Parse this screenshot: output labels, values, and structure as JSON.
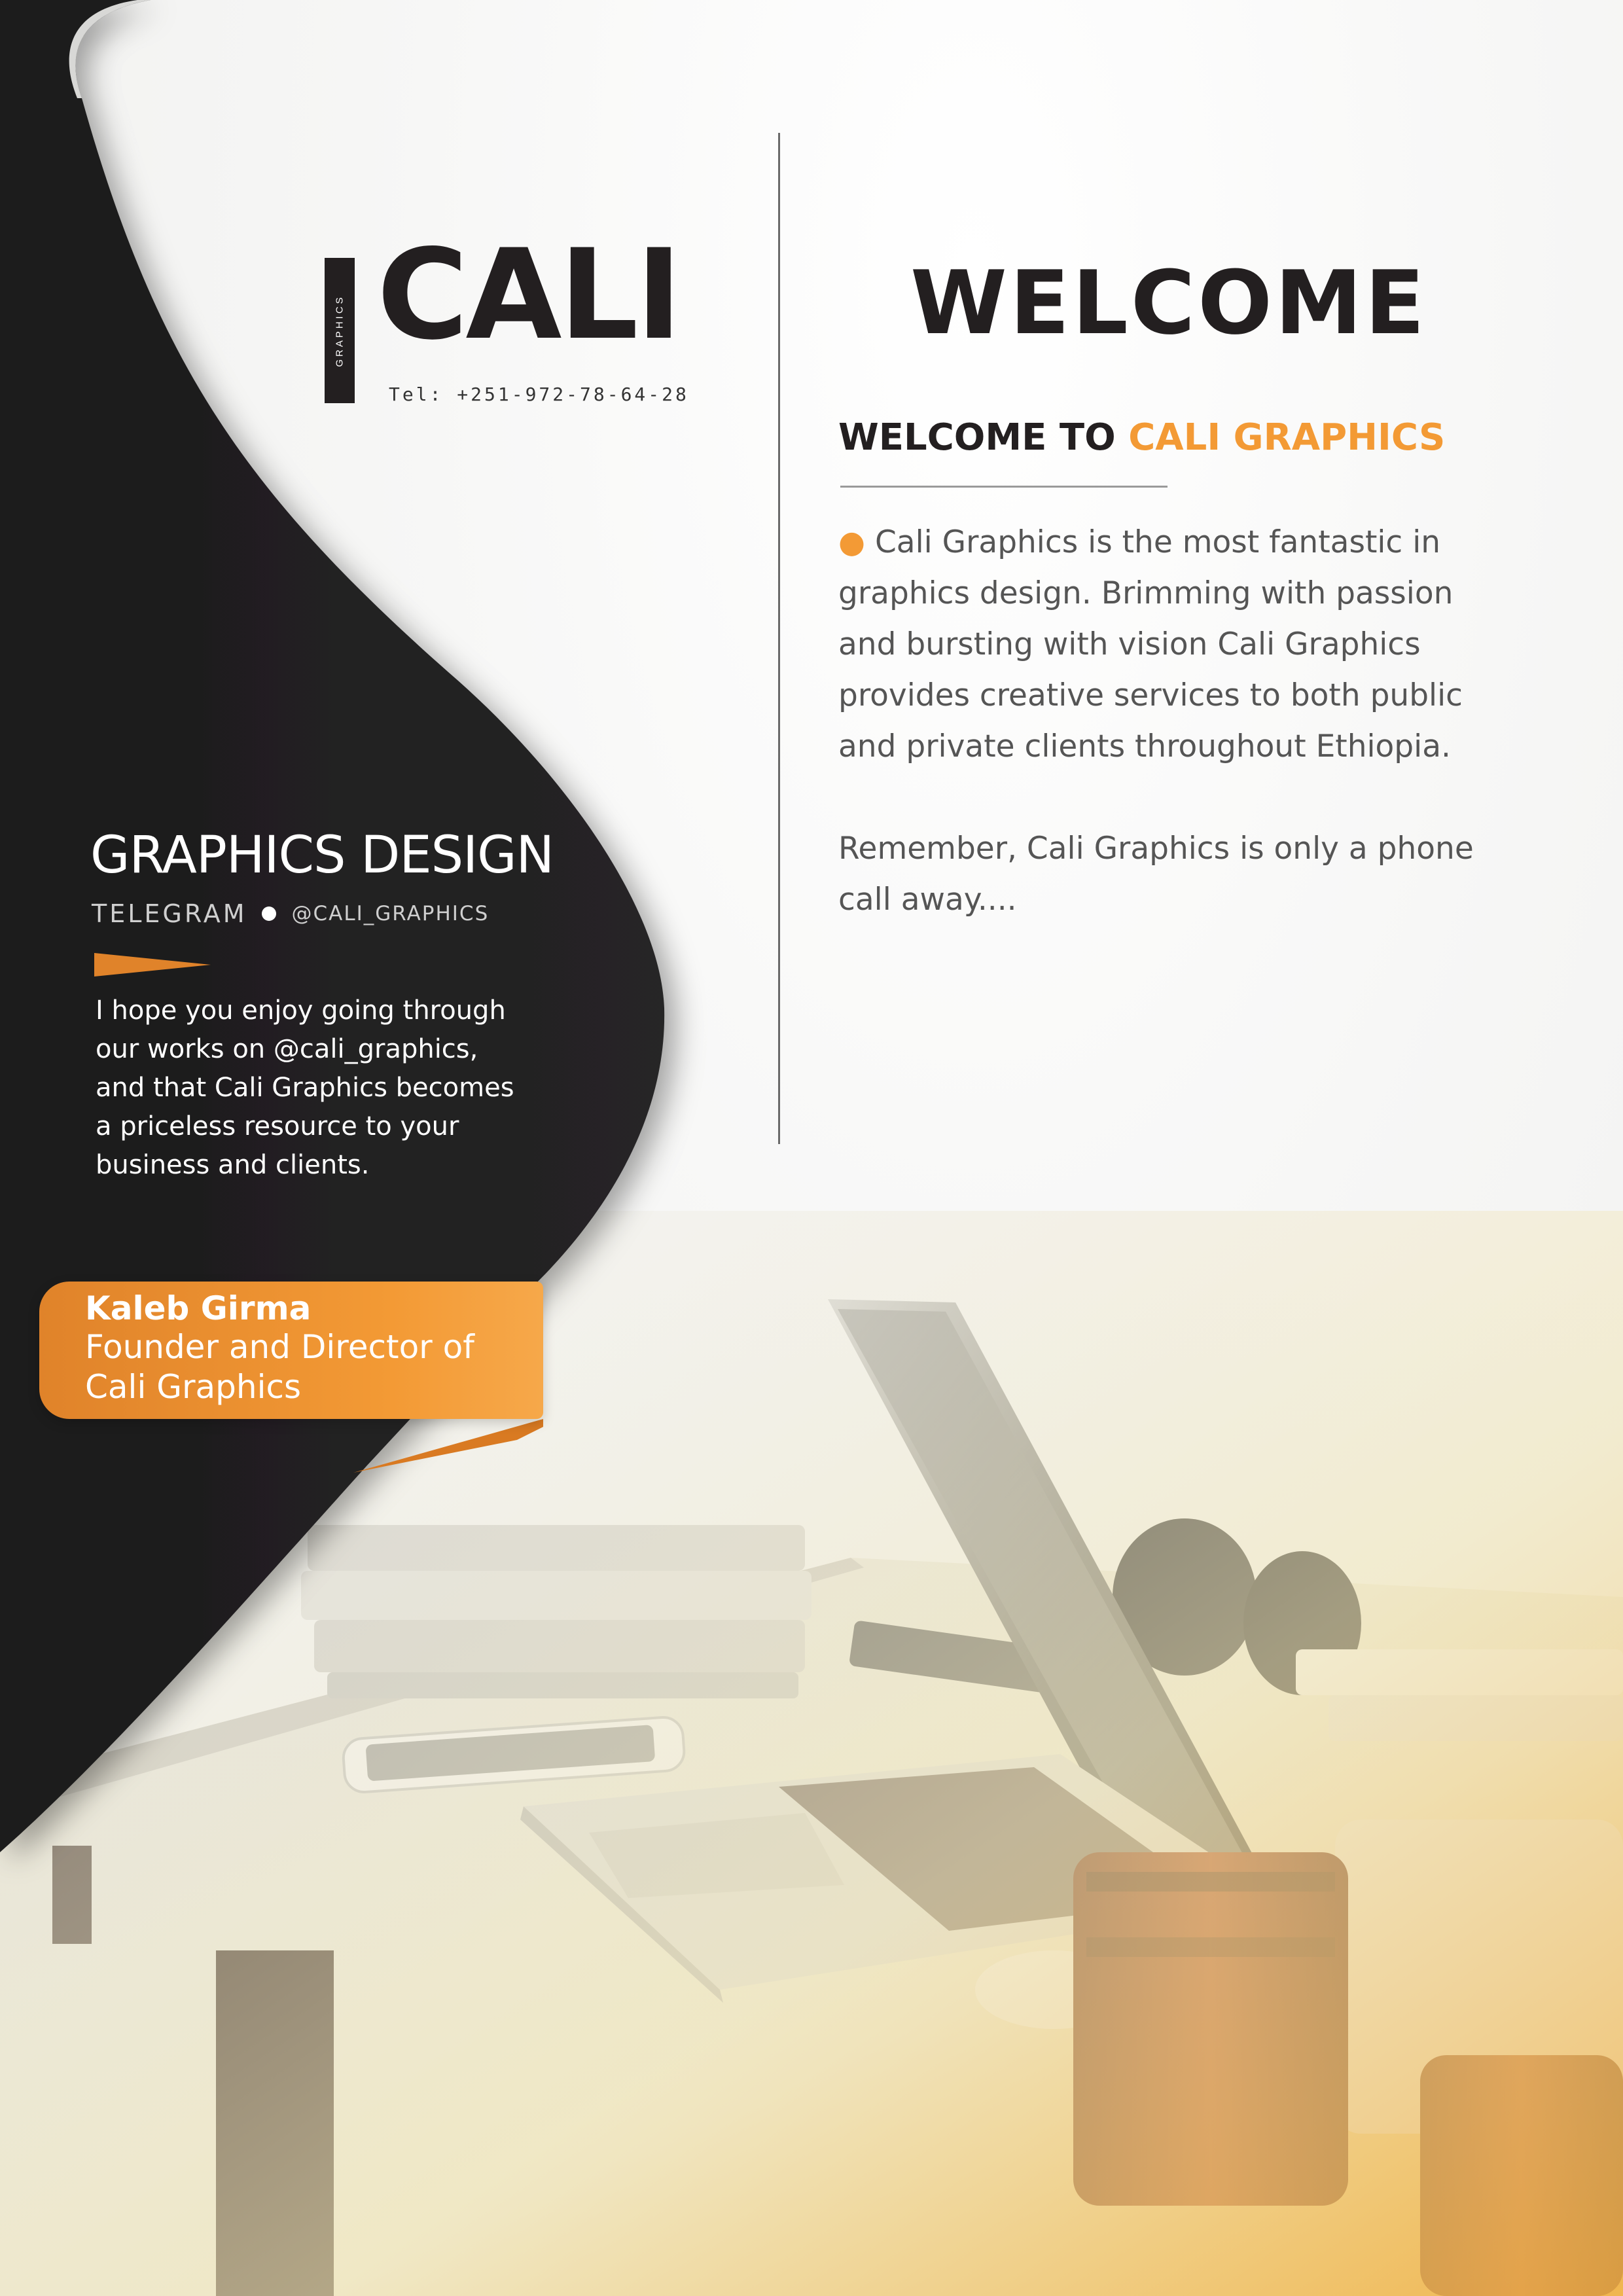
{
  "logo": {
    "wordmark": "CALI",
    "vertical_text": "GRAPHICS",
    "tel": "Tel: +251-972-78-64-28"
  },
  "welcome": {
    "title": "WELCOME",
    "subtitle_lead": "WELCOME TO",
    "subtitle_accent": "CALI GRAPHICS",
    "intro_bullet": "●",
    "intro": "Cali Graphics is the most fantastic in graphics design. Brimming with passion and bursting with vision Cali Graphics provides creative services to both public and private clients throughout Ethiopia.",
    "remember": "Remember, Cali Graphics is only a phone call away...."
  },
  "left_panel": {
    "title": "GRAPHICS DESIGN",
    "telegram_label": "TELEGRAM",
    "telegram_handle": "@CALI_GRAPHICS",
    "body": "I hope you enjoy going through our works on @cali_graphics, and that Cali Graphics becomes a priceless resource to your business and clients."
  },
  "signature": {
    "name": "Kaleb Girma",
    "role": "Founder and Director of Cali Graphics"
  },
  "colors": {
    "accent": "#f39a35",
    "dark": "#231f20",
    "text_gray": "#555555"
  },
  "image": {
    "description_icon": "laptop-desk-photo"
  }
}
